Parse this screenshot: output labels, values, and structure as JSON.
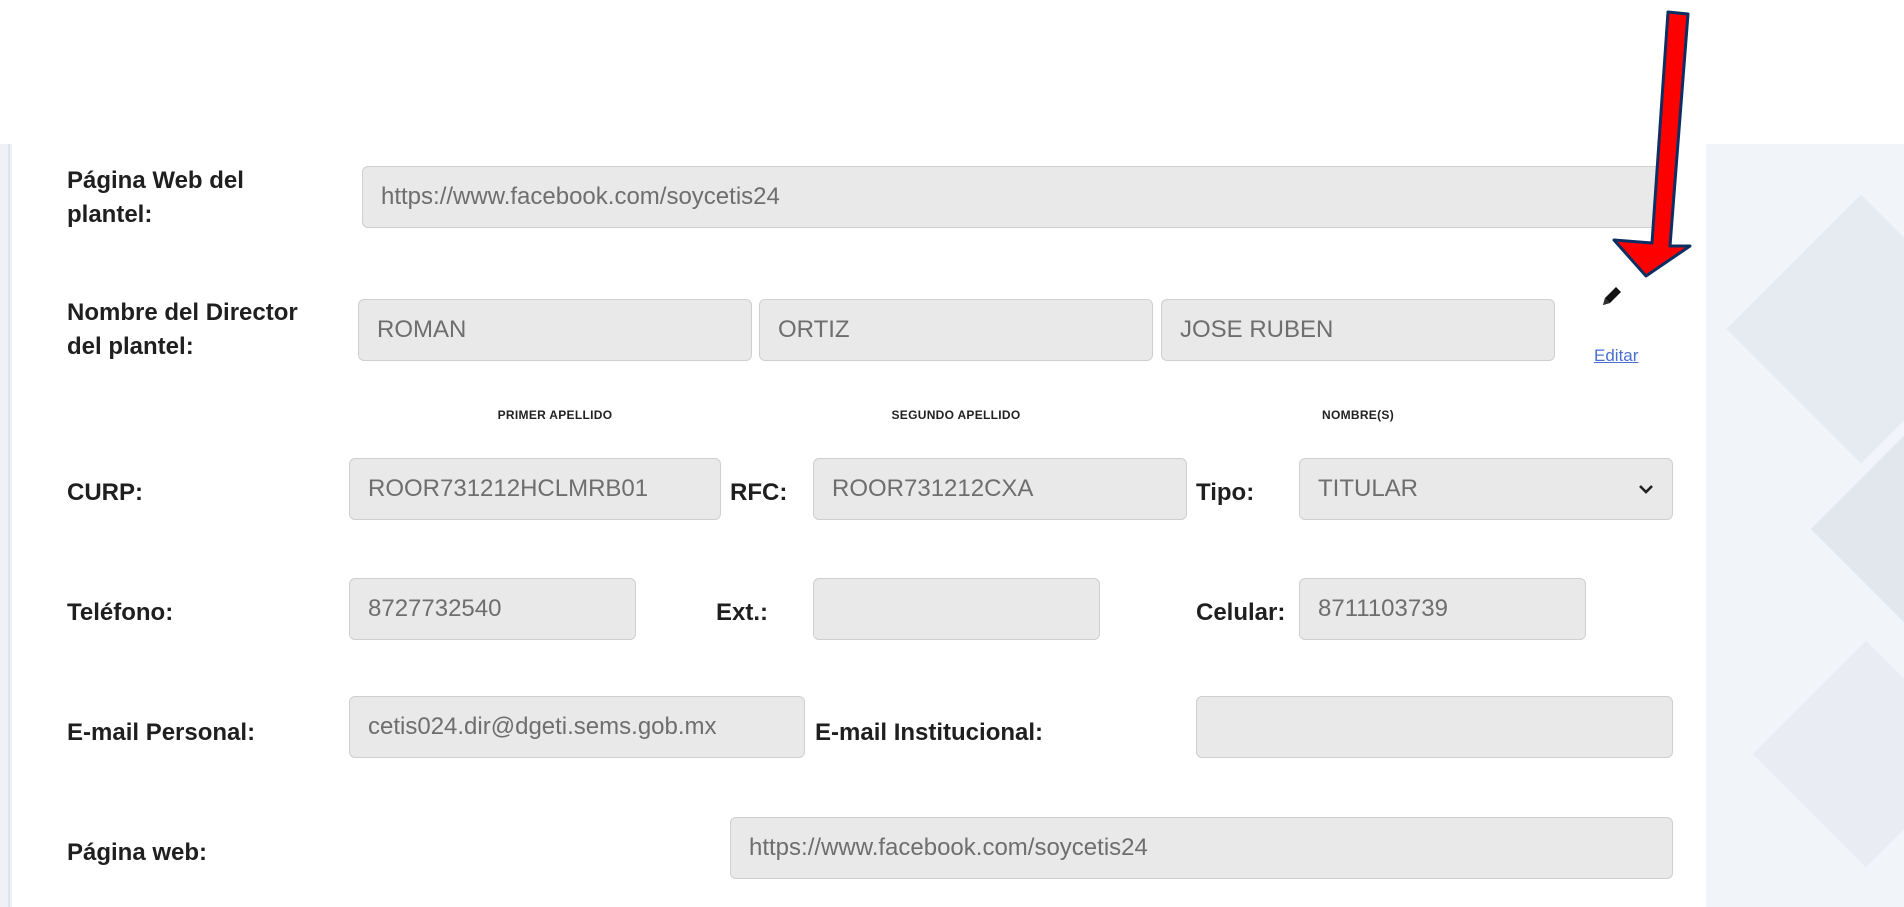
{
  "form": {
    "web_plantel": {
      "label": "Página Web del plantel:",
      "value": "https://www.facebook.com/soycetis24"
    },
    "director": {
      "label": "Nombre del Director del plantel:",
      "primer_apellido": "ROMAN",
      "segundo_apellido": "ORTIZ",
      "nombres": "JOSE RUBEN",
      "sublabels": {
        "primer": "PRIMER APELLIDO",
        "segundo": "SEGUNDO APELLIDO",
        "nombres": "NOMBRE(S)"
      },
      "edit_label": "Editar"
    },
    "curp": {
      "label": "CURP:",
      "value": "ROOR731212HCLMRB01"
    },
    "rfc": {
      "label": "RFC:",
      "value": "ROOR731212CXA"
    },
    "tipo": {
      "label": "Tipo:",
      "selected": "TITULAR"
    },
    "telefono": {
      "label": "Teléfono:",
      "value": "8727732540"
    },
    "ext": {
      "label": "Ext.:",
      "value": ""
    },
    "celular": {
      "label": "Celular:",
      "value": "8711103739"
    },
    "email_personal": {
      "label": "E-mail Personal:",
      "value": "cetis024.dir@dgeti.sems.gob.mx"
    },
    "email_institucional": {
      "label": "E-mail Institucional:",
      "value": ""
    },
    "pagina_web": {
      "label": "Página web:",
      "value": "https://www.facebook.com/soycetis24"
    }
  },
  "annotation": {
    "arrow_color": "#ff0000",
    "icon": "pencil-icon"
  }
}
